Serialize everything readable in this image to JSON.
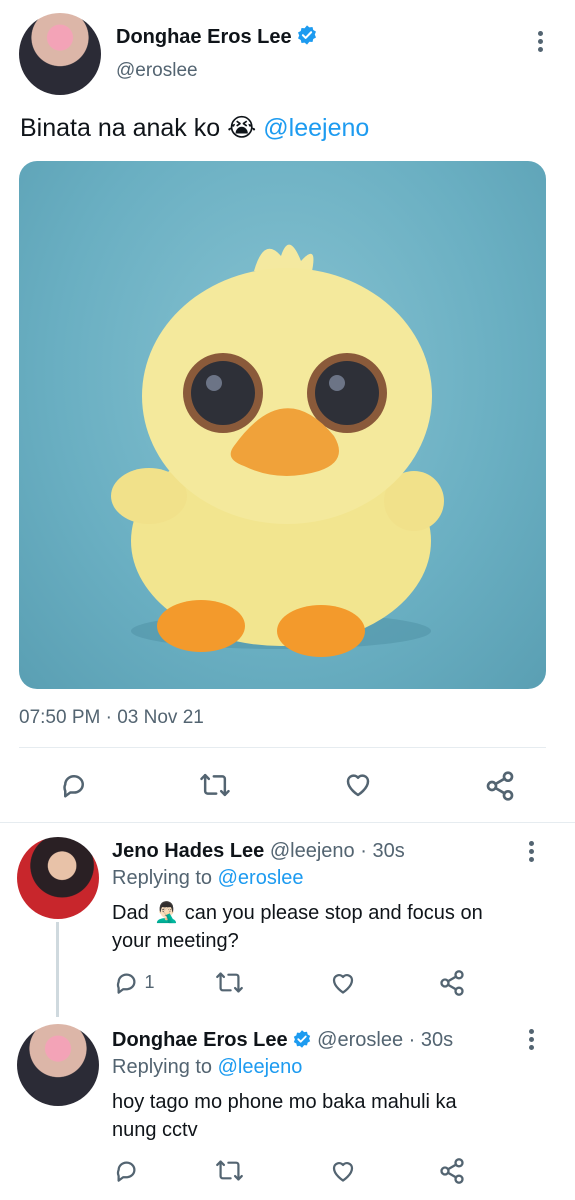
{
  "main_tweet": {
    "display_name": "Donghae Eros Lee",
    "handle": "@eroslee",
    "text_before": "Binata na anak ko",
    "emoji": "😭",
    "mention": "@leejeno",
    "timestamp": "07:50 PM · 03 Nov 21"
  },
  "replies": [
    {
      "display_name": "Jeno Hades Lee",
      "handle": "@leejeno",
      "age": "· 30s",
      "replying_prefix": "Replying to",
      "replying_to": "@eroslee",
      "text_line1_a": "Dad",
      "text_emoji": "🤦🏻‍♂️",
      "text_line1_b": "can you please stop and focus on",
      "text_line2": "your meeting?",
      "reply_count": "1"
    },
    {
      "display_name": "Donghae Eros Lee",
      "handle": "@eroslee",
      "age": "· 30s",
      "replying_prefix": "Replying to",
      "replying_to": "@leejeno",
      "text_line1": "hoy tago mo phone mo baka mahuli ka",
      "text_line2": "nung cctv"
    }
  ],
  "icons": [
    "more-vertical-icon",
    "verified-badge-icon",
    "reply-icon",
    "retweet-icon",
    "like-icon",
    "share-icon"
  ],
  "colors": {
    "accent": "#1d9bf0",
    "muted": "#536471",
    "divider": "#e6ecf0"
  }
}
